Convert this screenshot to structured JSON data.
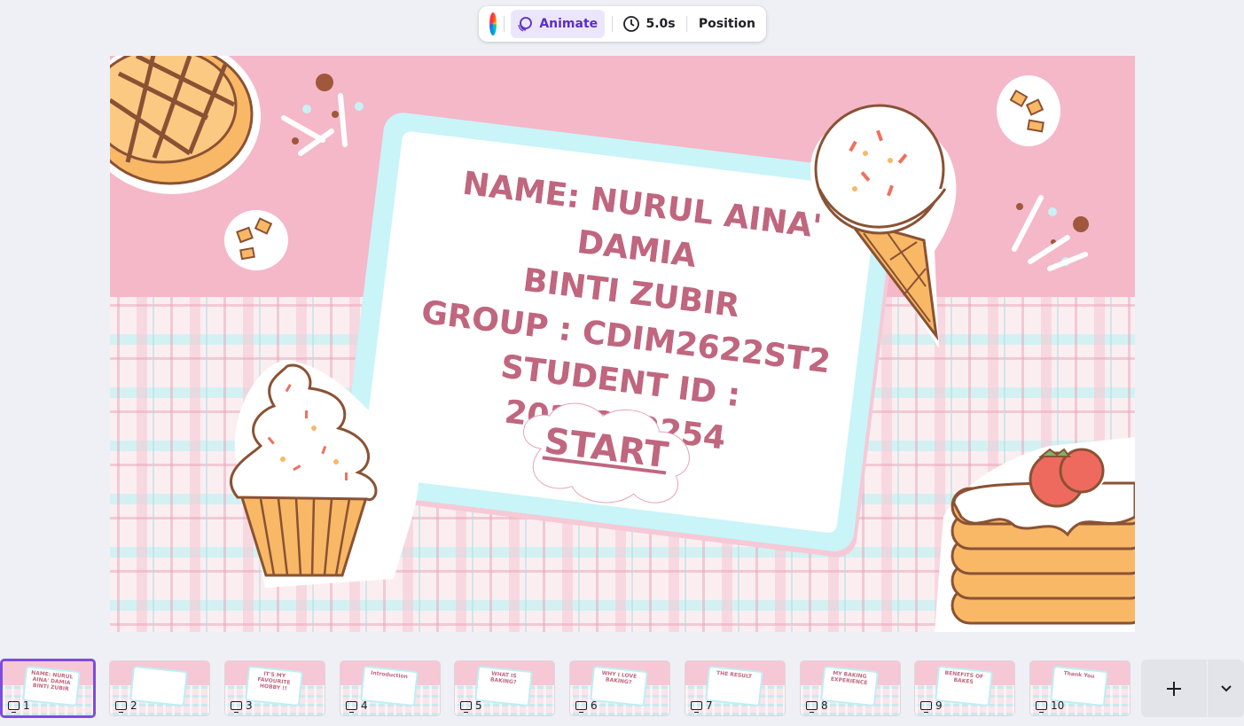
{
  "toolbar": {
    "color_icon": "color-wheel-icon",
    "animate_label": "Animate",
    "duration_label": "5.0s",
    "position_label": "Position"
  },
  "slide": {
    "lines": [
      "NAME: NURUL AINA' DAMIA",
      "BINTI ZUBIR",
      "GROUP : CDIM2622ST2",
      "STUDENT ID : 2024272254"
    ],
    "start_label": "START",
    "colors": {
      "pink_bg": "#f4b8c9",
      "card_border": "#c9f4f8",
      "text": "#c0667f"
    }
  },
  "thumbnails": [
    {
      "num": "1",
      "mini": "NAME: NURUL AINA' DAMIA BINTI ZUBIR"
    },
    {
      "num": "2",
      "mini": ""
    },
    {
      "num": "3",
      "mini": "IT'S MY FAVOURITE HOBBY !!"
    },
    {
      "num": "4",
      "mini": "Introduction"
    },
    {
      "num": "5",
      "mini": "WHAT IS BAKING?"
    },
    {
      "num": "6",
      "mini": "WHY I LOVE BAKING?"
    },
    {
      "num": "7",
      "mini": "THE RESULT"
    },
    {
      "num": "8",
      "mini": "MY BAKING EXPERIENCE"
    },
    {
      "num": "9",
      "mini": "BENEFITS OF BAKES"
    },
    {
      "num": "10",
      "mini": "Thank You"
    }
  ],
  "add_page_icon": "plus-icon",
  "more_icon": "chevron-down-icon"
}
